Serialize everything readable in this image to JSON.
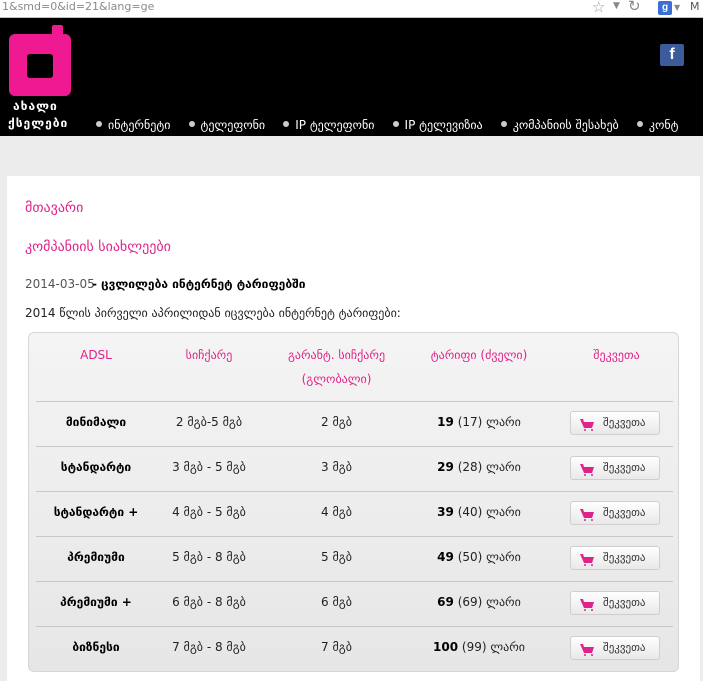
{
  "browser": {
    "url": "1&smd=0&id=21&lang=ge",
    "star_glyph": "☆",
    "dropdown_glyph": "▼",
    "reload_glyph": "↻",
    "search_engine_letter": "g",
    "search_text": "M"
  },
  "header": {
    "logo_line1": "ახალი",
    "logo_line2": "ქსელები",
    "social_icon": "f",
    "nav": [
      "ინტერნეტი",
      "ტელეფონი",
      "IP ტელეფონი",
      "IP ტელევიზია",
      "კომპანიის შესახებ",
      "კონტ"
    ]
  },
  "content": {
    "home_link": "მთავარი",
    "news_link": "კომპანიის სიახლეები",
    "news_date": "2014-03-05",
    "news_title": "- ცვლილება ინტერნეტ ტარიფებში",
    "news_text": "2014 წლის პირველი აპრილიდან იცვლება ინტერნეტ ტარიფები:"
  },
  "tariffs": {
    "headers": {
      "adsl": "ADSL",
      "speed": "სიჩქარე",
      "guaranteed_line1": "გარანტ. სიჩქარე",
      "guaranteed_line2": "(გლობალი)",
      "price": "ტარიფი (ძველი)",
      "order": "შეკვეთა"
    },
    "rows": [
      {
        "name": "მინიმალი",
        "speed": "2 მგბ-5 მგბ",
        "guaranteed": "2 მგბ",
        "price_new": "19",
        "price_old": "(17)",
        "currency": "ლარი",
        "order_label": "შეკვეთა"
      },
      {
        "name": "სტანდარტი",
        "speed": "3 მგბ - 5 მგბ",
        "guaranteed": "3 მგბ",
        "price_new": "29",
        "price_old": "(28)",
        "currency": "ლარი",
        "order_label": "შეკვეთა"
      },
      {
        "name": "სტანდარტი +",
        "speed": "4 მგბ - 5 მგბ",
        "guaranteed": "4 მგბ",
        "price_new": "39",
        "price_old": "(40)",
        "currency": "ლარი",
        "order_label": "შეკვეთა"
      },
      {
        "name": "პრემიუმი",
        "speed": "5 მგბ - 8 მგბ",
        "guaranteed": "5 მგბ",
        "price_new": "49",
        "price_old": "(50)",
        "currency": "ლარი",
        "order_label": "შეკვეთა"
      },
      {
        "name": "პრემიუმი +",
        "speed": "6 მგბ - 8 მგბ",
        "guaranteed": "6 მგბ",
        "price_new": "69",
        "price_old": "(69)",
        "currency": "ლარი",
        "order_label": "შეკვეთა"
      },
      {
        "name": "ბიზნესი",
        "speed": "7 მგბ - 8 მგბ",
        "guaranteed": "7 მგბ",
        "price_new": "100",
        "price_old": "(99)",
        "currency": "ლარი",
        "order_label": "შეკვეთა"
      }
    ]
  },
  "colors": {
    "accent": "#e0238a",
    "logo": "#ef1a91",
    "header_bg": "#000000"
  }
}
